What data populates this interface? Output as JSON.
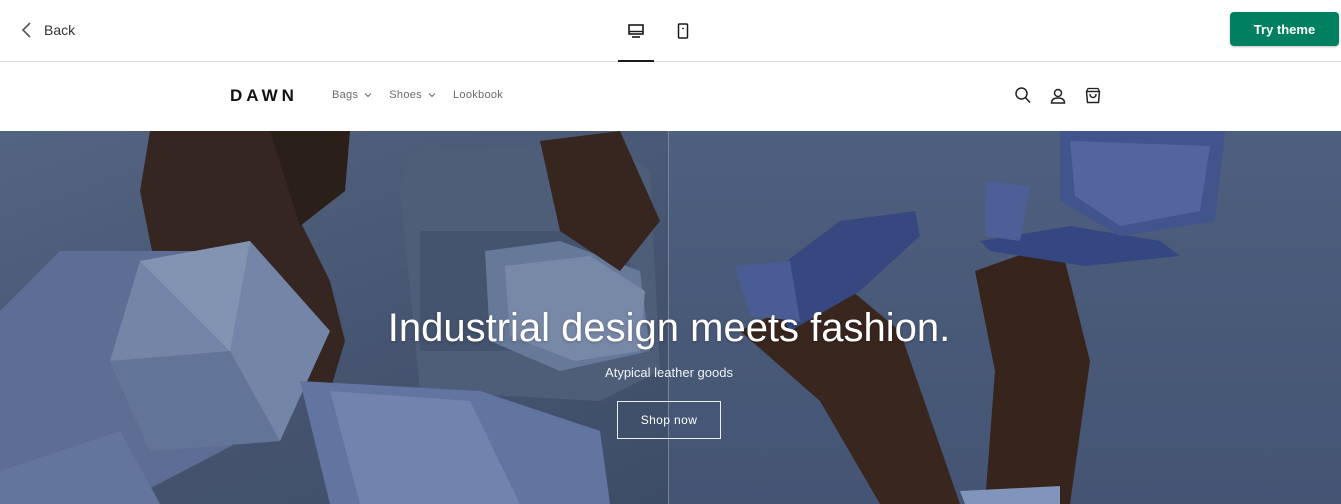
{
  "preview_bar": {
    "back_label": "Back",
    "devices": [
      {
        "icon": "desktop-icon",
        "active": true
      },
      {
        "icon": "mobile-icon",
        "active": false
      }
    ],
    "try_theme_label": "Try theme",
    "accent_color": "#008060"
  },
  "store": {
    "logo": "DAWN",
    "nav": [
      {
        "label": "Bags",
        "dropdown": true
      },
      {
        "label": "Shoes",
        "dropdown": true
      },
      {
        "label": "Lookbook",
        "dropdown": false
      }
    ],
    "icons": [
      "search-icon",
      "account-icon",
      "cart-icon"
    ]
  },
  "hero": {
    "title": "Industrial design meets fashion.",
    "subtitle": "Atypical leather goods",
    "button_label": "Shop now",
    "background_color": "#4f5f7d"
  }
}
